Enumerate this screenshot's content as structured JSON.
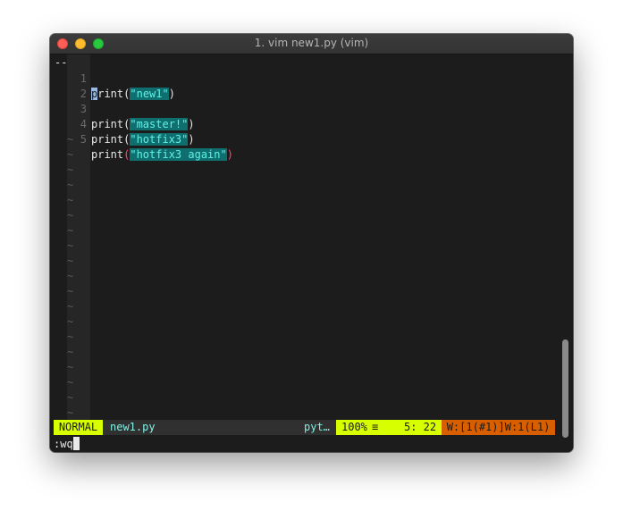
{
  "window": {
    "title": "1. vim new1.py (vim)"
  },
  "gutter": {
    "marker": "--"
  },
  "lines": [
    {
      "num": "1",
      "fn": "print",
      "open": "(",
      "str": "\"new1\"",
      "close": ")"
    },
    {
      "num": "2"
    },
    {
      "num": "3",
      "fn": "print",
      "open": "(",
      "str": "\"master!\"",
      "close": ")"
    },
    {
      "num": "4",
      "fn": "print",
      "open": "(",
      "str": "\"hotfix3\"",
      "close": ")"
    },
    {
      "num": "5",
      "fn": "print",
      "open": "(",
      "str": "\"hotfix3 again\"",
      "close": ")"
    }
  ],
  "tilde": "~",
  "statusline": {
    "mode": "NORMAL",
    "filename": "new1.py",
    "filetype": "pyt…",
    "percent": "100%",
    "menu_icon": "≡",
    "linecol": "5: 22",
    "warnings": "W:[1(#1)]W:1(L1)"
  },
  "cmdline": {
    "text": ":wq"
  },
  "icons": {
    "close": "close-icon",
    "minimize": "minimize-icon",
    "zoom": "zoom-icon"
  }
}
